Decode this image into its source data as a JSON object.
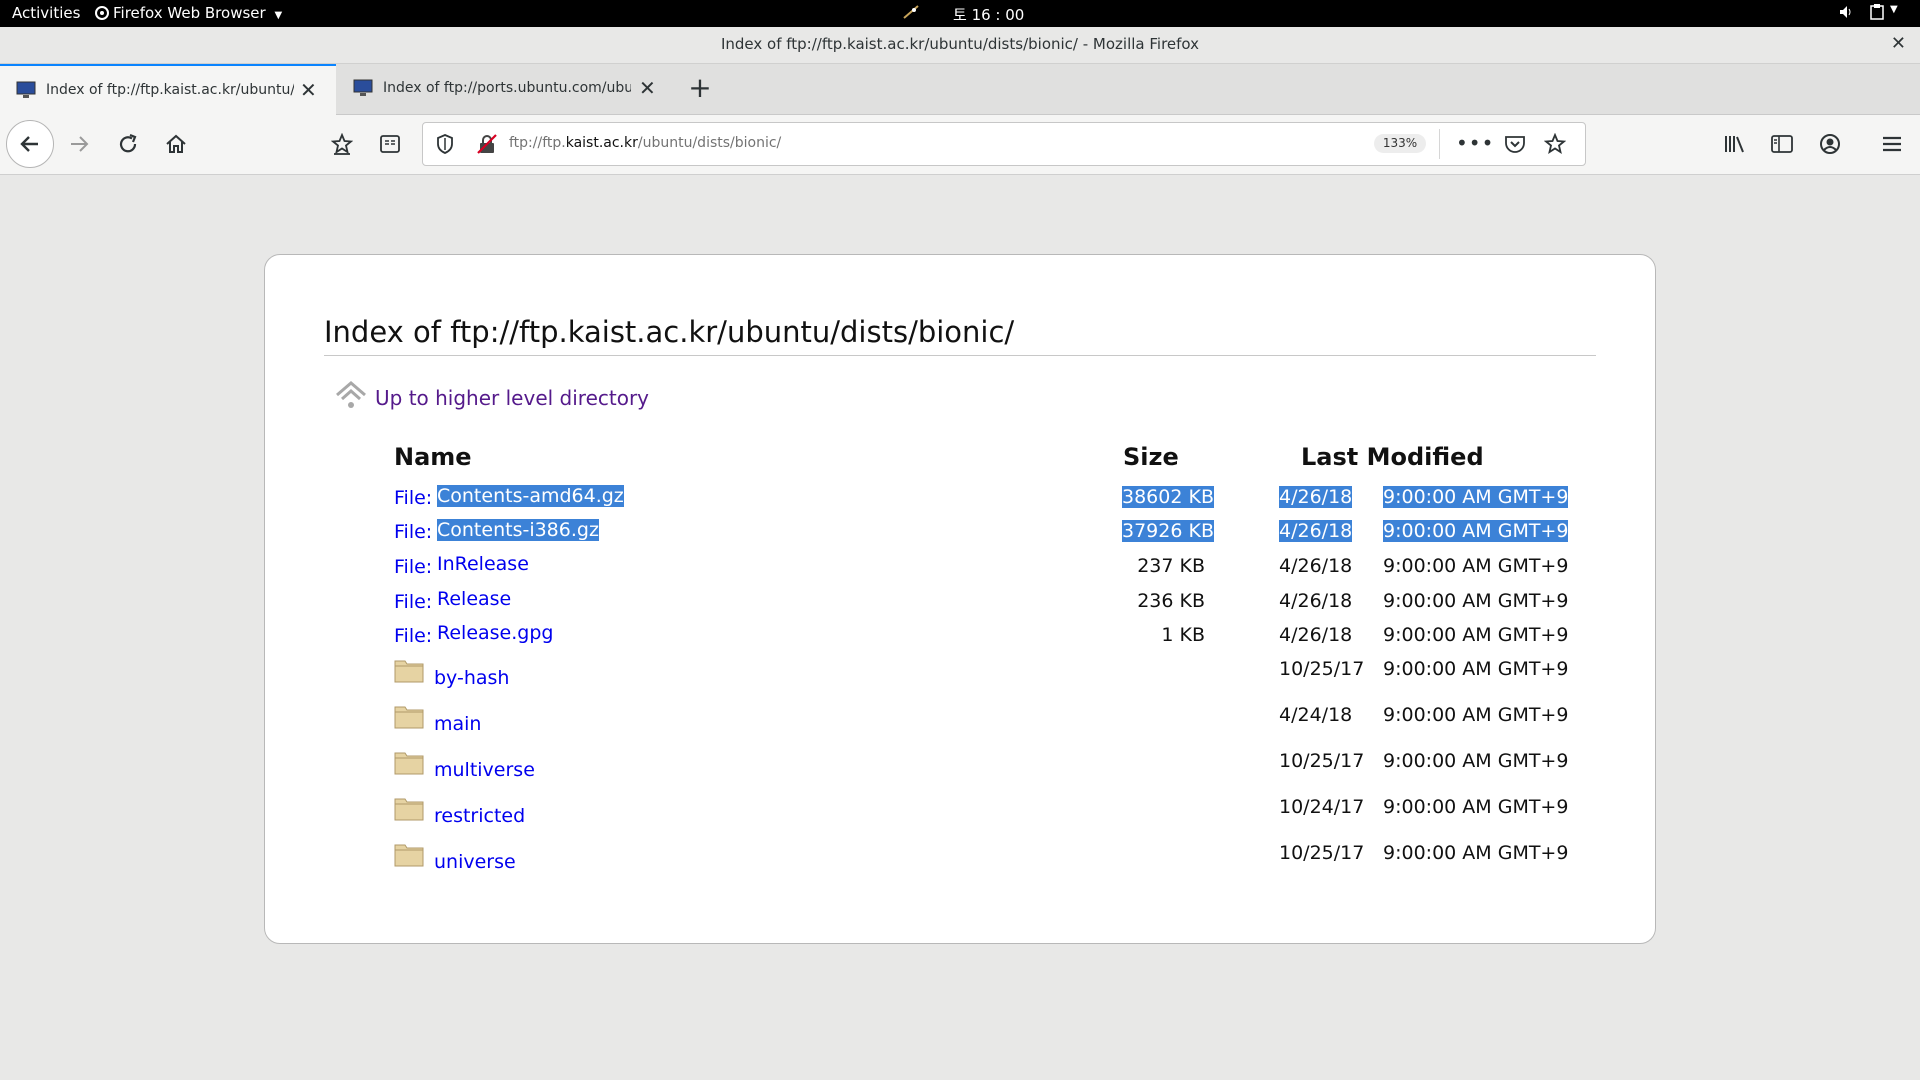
{
  "gnome": {
    "activities": "Activities",
    "app_name": "Firefox Web Browser",
    "clock": "토 16 : 00"
  },
  "window": {
    "title": "Index of ftp://ftp.kaist.ac.kr/ubuntu/dists/bionic/ - Mozilla Firefox"
  },
  "tabs": [
    {
      "label": "Index of ftp://ftp.kaist.ac.kr/ubuntu/dists/bionic/",
      "active": true
    },
    {
      "label": "Index of ftp://ports.ubuntu.com/ubuntu-ports/",
      "active": false
    }
  ],
  "urlbar": {
    "url_prefix": "ftp://ftp.",
    "url_domain": "kaist.ac.kr",
    "url_path": "/ubuntu/dists/bionic/",
    "zoom": "133%"
  },
  "page": {
    "heading": "Index of ftp://ftp.kaist.ac.kr/ubuntu/dists/bionic/",
    "up_link": "Up to higher level directory",
    "columns": {
      "name": "Name",
      "size": "Size",
      "modified": "Last Modified"
    },
    "file_prefix": "File:",
    "files": [
      {
        "name": "Contents-amd64.gz",
        "size": "38602 KB",
        "date": "4/26/18",
        "time": "9:00:00 AM GMT+9",
        "selected": true
      },
      {
        "name": "Contents-i386.gz",
        "size": "37926 KB",
        "date": "4/26/18",
        "time": "9:00:00 AM GMT+9",
        "selected": true
      },
      {
        "name": "InRelease",
        "size": "237 KB",
        "date": "4/26/18",
        "time": "9:00:00 AM GMT+9",
        "selected": false
      },
      {
        "name": "Release",
        "size": "236 KB",
        "date": "4/26/18",
        "time": "9:00:00 AM GMT+9",
        "selected": false
      },
      {
        "name": "Release.gpg",
        "size": "1 KB",
        "date": "4/26/18",
        "time": "9:00:00 AM GMT+9",
        "selected": false
      }
    ],
    "folders": [
      {
        "name": "by-hash",
        "date": "10/25/17",
        "time": "9:00:00 AM GMT+9"
      },
      {
        "name": "main",
        "date": "4/24/18",
        "time": "9:00:00 AM GMT+9"
      },
      {
        "name": "multiverse",
        "date": "10/25/17",
        "time": "9:00:00 AM GMT+9"
      },
      {
        "name": "restricted",
        "date": "10/24/17",
        "time": "9:00:00 AM GMT+9"
      },
      {
        "name": "universe",
        "date": "10/25/17",
        "time": "9:00:00 AM GMT+9"
      }
    ]
  },
  "colors": {
    "link": "#0000ee",
    "visited": "#551a8b",
    "selection": "#3c82d7",
    "tab_accent": "#0a84ff"
  }
}
